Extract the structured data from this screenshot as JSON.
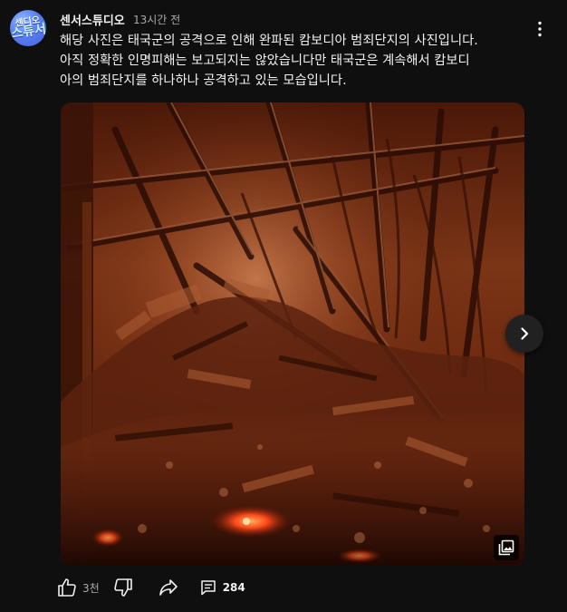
{
  "channel": {
    "name": "센서스튜디오",
    "avatar_text_top": "센디오",
    "avatar_text_bottom": "스튜서",
    "timestamp": "13시간 전"
  },
  "post": {
    "lines": [
      "해당 사진은 태국군의 공격으로 인해 완파된 캄보디아 범죄단지의 사진입니다.",
      "아직 정확한 인명피해는 보고되지는 않았습니다만 태국군은 계속해서 캄보디",
      "아의 범죄단지를 하나하나 공격하고 있는 모습입니다."
    ]
  },
  "image": {
    "alt_icon": "gallery-icon"
  },
  "actions": {
    "like_count": "3천",
    "comment_count": "284"
  },
  "colors": {
    "background": "#0f0f0f",
    "text": "#f1f1f1",
    "secondary_text": "#aaaaaa",
    "fire_glow": "#ff5a1e"
  }
}
